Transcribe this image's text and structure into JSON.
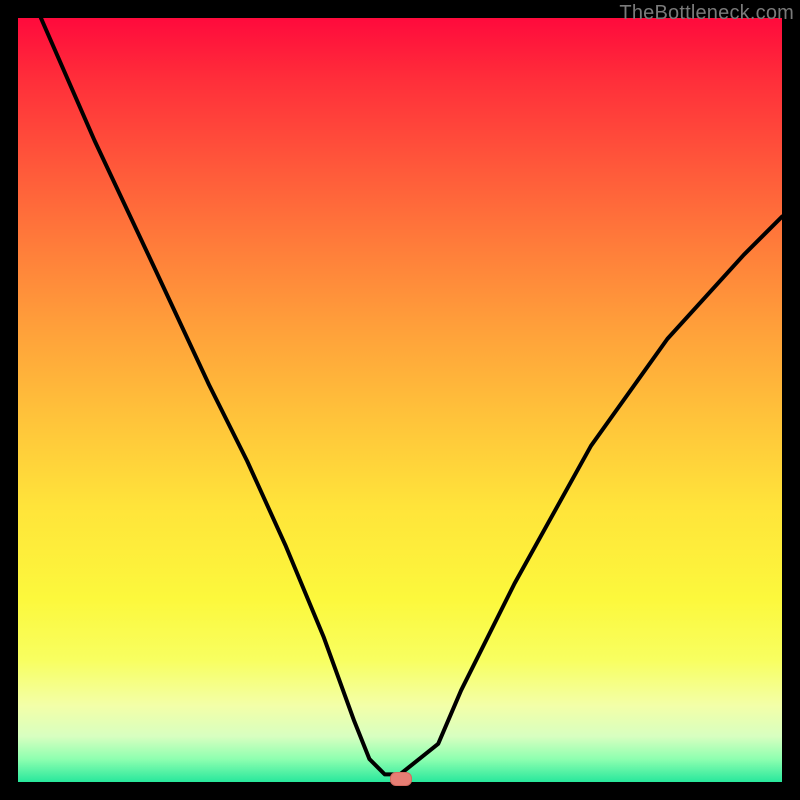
{
  "watermark": "TheBottleneck.com",
  "chart_data": {
    "type": "line",
    "title": "",
    "xlabel": "",
    "ylabel": "",
    "xlim": [
      0,
      100
    ],
    "ylim": [
      0,
      100
    ],
    "curve": {
      "name": "bottleneck-curve",
      "x": [
        3,
        10,
        18,
        25,
        30,
        35,
        40,
        44,
        46,
        48,
        50,
        55,
        58,
        65,
        75,
        85,
        95,
        100
      ],
      "y": [
        100,
        84,
        67,
        52,
        42,
        31,
        19,
        8,
        3,
        1,
        1,
        5,
        12,
        26,
        44,
        58,
        69,
        74
      ]
    },
    "marker": {
      "x": 50,
      "y": 0.5
    },
    "gradient_direction": "vertical",
    "colors": {
      "top": "#ff0a3c",
      "bottom": "#28e89c"
    }
  },
  "marker_color": "#e77e74"
}
